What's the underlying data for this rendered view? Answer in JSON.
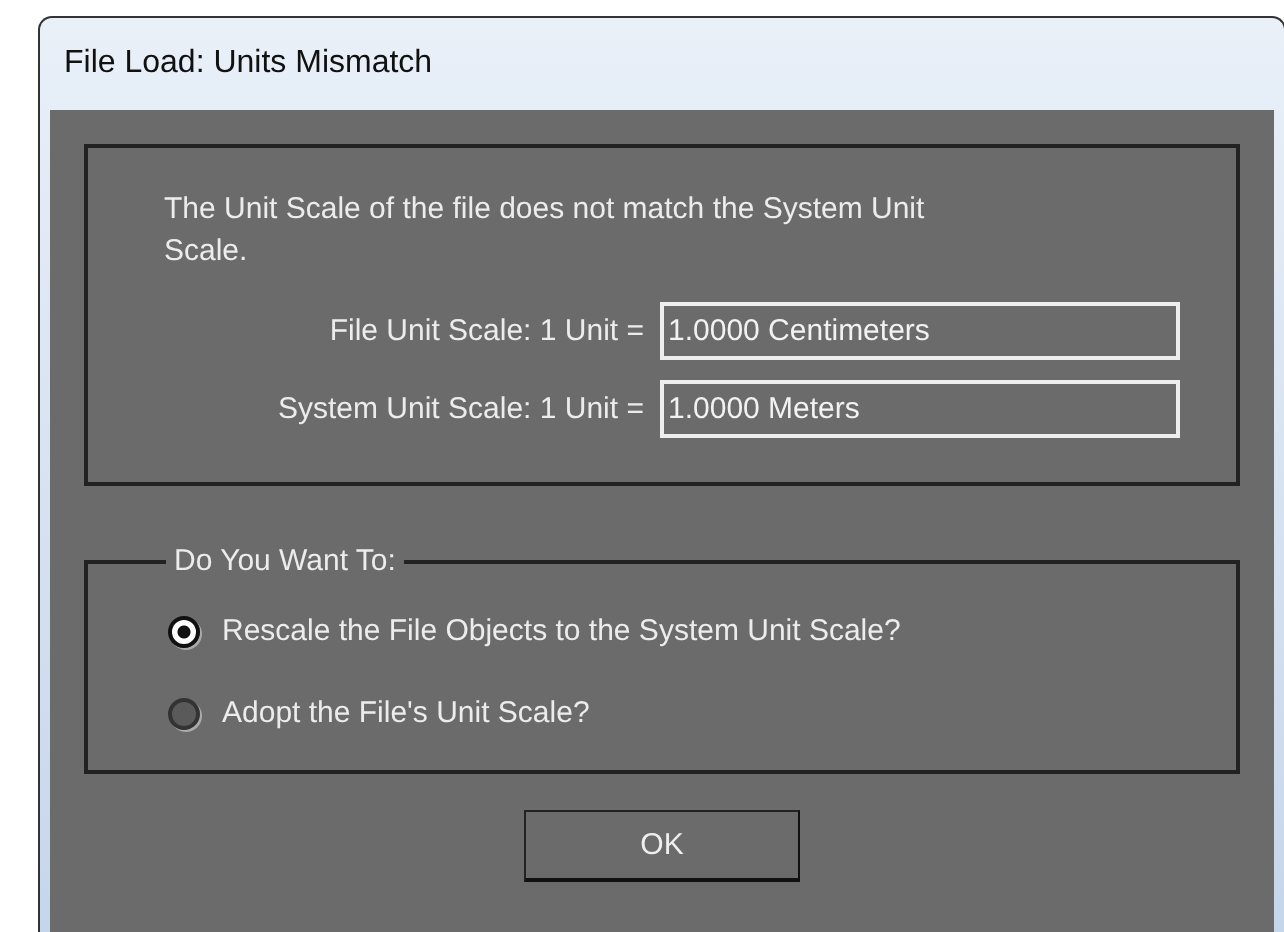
{
  "window": {
    "title": "File Load: Units Mismatch"
  },
  "message": "The Unit Scale of the file does not match the System Unit Scale.",
  "fields": [
    {
      "label": "File Unit Scale: 1 Unit =",
      "value": "1.0000 Centimeters"
    },
    {
      "label": "System Unit Scale: 1 Unit =",
      "value": "1.0000 Meters"
    }
  ],
  "options": {
    "title": "Do You Want To:",
    "items": [
      {
        "label": "Rescale the File Objects to the System Unit Scale?",
        "selected": true
      },
      {
        "label": "Adopt the File's Unit Scale?",
        "selected": false
      }
    ]
  },
  "buttons": [
    "OK"
  ]
}
